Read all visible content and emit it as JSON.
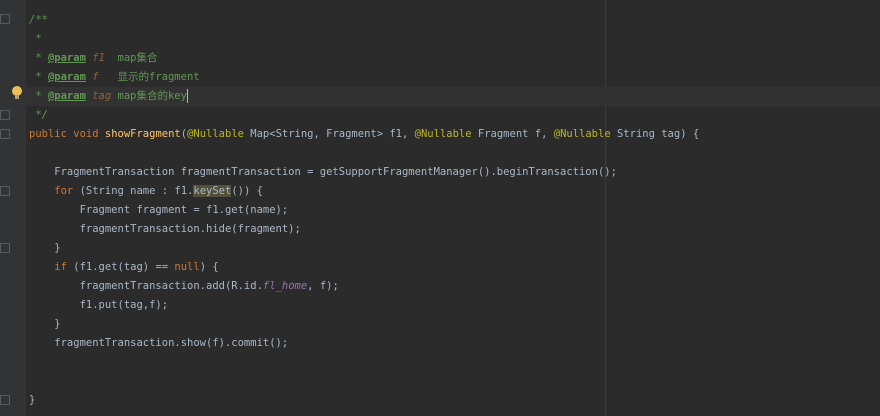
{
  "editor": {
    "lines": {
      "l1": "/**",
      "l2": " *",
      "l3_star": " * ",
      "l3_tag": "@param",
      "l3_name": " f1 ",
      "l3_desc": " map集合",
      "l4_star": " * ",
      "l4_tag": "@param",
      "l4_name": " f ",
      "l4_desc": "  显示的fragment",
      "l5_star": " * ",
      "l5_tag": "@param",
      "l5_name": " tag",
      "l5_desc": " map集合的key",
      "l6": " */",
      "l7_mod": "public ",
      "l7_void": "void ",
      "l7_fn": "showFragment",
      "l7_p1": "(",
      "l7_ann1": "@Nullable",
      "l7_t1": " Map<String, Fragment> f1, ",
      "l7_ann2": "@Nullable",
      "l7_t2": " Fragment f, ",
      "l7_ann3": "@Nullable",
      "l7_t3": " String tag) {",
      "l9": "    FragmentTransaction fragmentTransaction = getSupportFragmentManager().beginTransaction();",
      "l10_for": "    for",
      "l10_a": " (String name : f1.",
      "l10_hl": "keySet",
      "l10_b": "()) {",
      "l11": "        Fragment fragment = f1.get(name);",
      "l12": "        fragmentTransaction.hide(fragment);",
      "l13": "    }",
      "l14_if": "    if",
      "l14_a": " (f1.get(tag) == ",
      "l14_null": "null",
      "l14_b": ") {",
      "l15_a": "        fragmentTransaction.add(R.id.",
      "l15_fld": "fl_home",
      "l15_b": ", f);",
      "l16": "        f1.put(tag,f);",
      "l17": "    }",
      "l18": "    fragmentTransaction.show(f).commit();",
      "l21": "}"
    },
    "colors": {
      "background": "#2b2b2b",
      "keyword": "#cc7832",
      "method": "#ffc66d",
      "annotation": "#bbb529",
      "comment": "#629755",
      "field": "#9876aa",
      "text": "#a9b7c6"
    },
    "icons": [
      "fold-icon",
      "lightbulb-icon"
    ]
  }
}
